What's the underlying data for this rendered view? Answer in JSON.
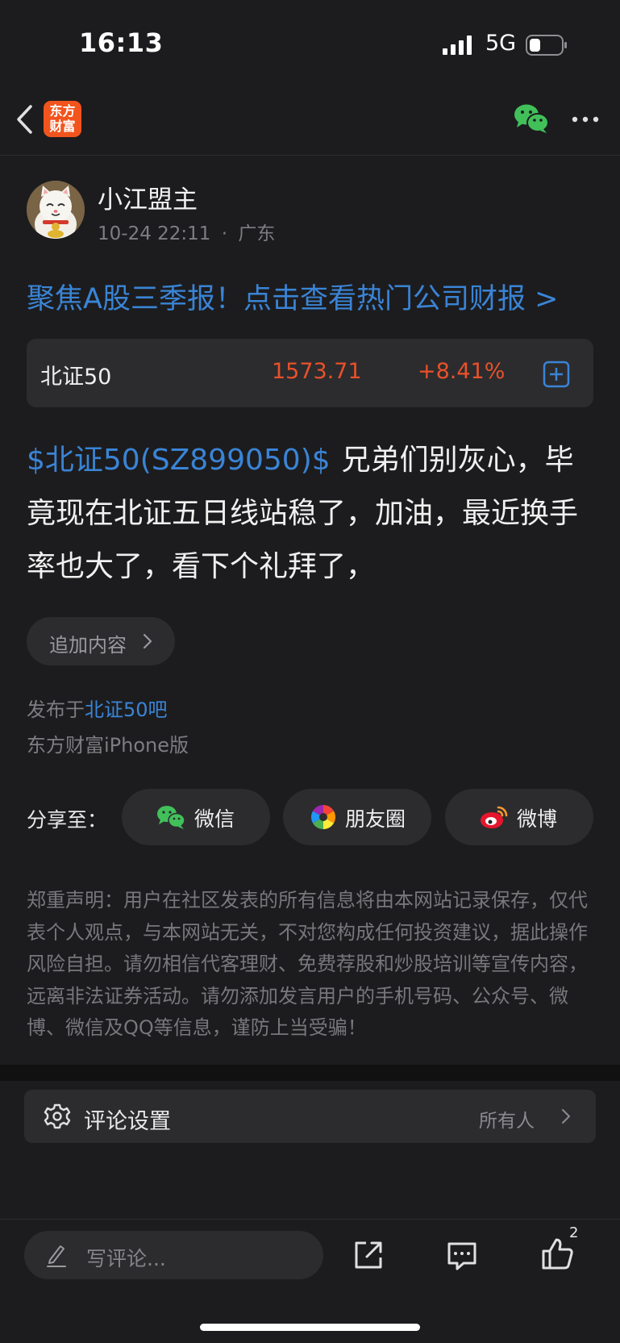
{
  "status_bar": {
    "time": "16:13",
    "network": "5G"
  },
  "nav": {
    "logo_line1": "东方",
    "logo_line2": "财富"
  },
  "author": {
    "name": "小江盟主",
    "date": "10-24 22:11",
    "separator": "·",
    "location": "广东"
  },
  "promo": {
    "text": "聚焦A股三季报！点击查看热门公司财报 >"
  },
  "stock": {
    "name": "北证50",
    "price": "1573.71",
    "change": "+8.41%",
    "color": "#e9512a"
  },
  "post": {
    "stock_link": "$北证50(SZ899050)$",
    "body": "兄弟们别灰心，毕竟现在北证五日线站稳了，加油，最近换手率也大了，看下个礼拜了，"
  },
  "append": {
    "label": "追加内容"
  },
  "published": {
    "prefix": "发布于",
    "bar_name": "北证50吧"
  },
  "client": "东方财富iPhone版",
  "share": {
    "label": "分享至：",
    "options": [
      {
        "label": "微信",
        "icon": "wechat-icon"
      },
      {
        "label": "朋友圈",
        "icon": "moments-icon"
      },
      {
        "label": "微博",
        "icon": "weibo-icon"
      }
    ]
  },
  "disclaimer": "郑重声明：用户在社区发表的所有信息将由本网站记录保存，仅代表个人观点，与本网站无关，不对您构成任何投资建议，据此操作风险自担。请勿相信代客理财、免费荐股和炒股培训等宣传内容，远离非法证券活动。请勿添加发言用户的手机号码、公众号、微博、微信及QQ等信息，谨防上当受骗！",
  "comment_settings": {
    "label": "评论设置",
    "value": "所有人"
  },
  "bottom_bar": {
    "placeholder": "写评论...",
    "like_count": "2"
  },
  "colors": {
    "accent_blue": "#3a84d6",
    "red": "#e9512a",
    "background": "#1c1c1e",
    "card": "#2c2c2e",
    "logo": "#f2541d"
  }
}
